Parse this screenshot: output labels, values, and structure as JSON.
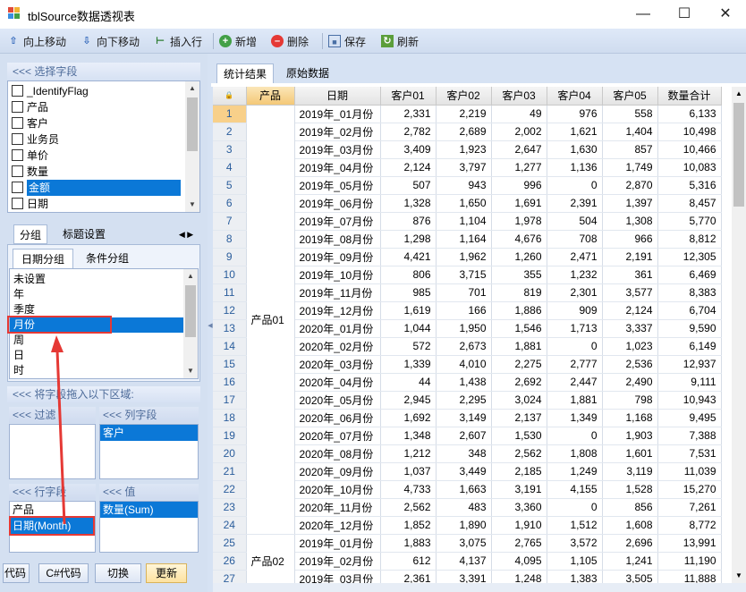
{
  "window": {
    "title": "tblSource数据透视表"
  },
  "toolbar": {
    "move_up": "向上移动",
    "move_down": "向下移动",
    "insert_row": "插入行",
    "add": "新增",
    "delete": "删除",
    "save": "保存",
    "refresh": "刷新"
  },
  "fields": {
    "header": "<<< 选择字段",
    "items": [
      "_IdentifyFlag",
      "产品",
      "客户",
      "业务员",
      "单价",
      "数量",
      "金额",
      "日期"
    ],
    "selected": "金额"
  },
  "group_tabs": {
    "tab1": "分组",
    "tab2": "标题设置"
  },
  "sub_tabs": {
    "tab1": "日期分组",
    "tab2": "条件分组"
  },
  "date_group": {
    "items": [
      "未设置",
      "年",
      "季度",
      "月份",
      "周",
      "日",
      "时"
    ],
    "selected": "月份"
  },
  "drop_area": {
    "header": "<<< 将字段拖入以下区域:",
    "filter_header": "<<< 过滤",
    "column_header": "<<< 列字段",
    "column_items": [
      "客户"
    ],
    "row_header": "<<< 行字段",
    "row_items": [
      "产品",
      "日期(Month)"
    ],
    "value_header": "<<< 值",
    "value_items": [
      "数量(Sum)"
    ]
  },
  "bottom_buttons": {
    "code": "代码",
    "csharp": "C#代码",
    "switch": "切换",
    "update": "更新"
  },
  "result_tabs": {
    "tab1": "统计结果",
    "tab2": "原始数据"
  },
  "grid": {
    "columns": [
      "产品",
      "日期",
      "客户01",
      "客户02",
      "客户03",
      "客户04",
      "客户05",
      "数量合计"
    ],
    "groups": [
      {
        "name": "产品01",
        "rows": 24
      },
      {
        "name": "产品02",
        "rows": 3
      }
    ],
    "rows": [
      [
        "1",
        "2019年_01月份",
        "2,331",
        "2,219",
        "49",
        "976",
        "558",
        "6,133"
      ],
      [
        "2",
        "2019年_02月份",
        "2,782",
        "2,689",
        "2,002",
        "1,621",
        "1,404",
        "10,498"
      ],
      [
        "3",
        "2019年_03月份",
        "3,409",
        "1,923",
        "2,647",
        "1,630",
        "857",
        "10,466"
      ],
      [
        "4",
        "2019年_04月份",
        "2,124",
        "3,797",
        "1,277",
        "1,136",
        "1,749",
        "10,083"
      ],
      [
        "5",
        "2019年_05月份",
        "507",
        "943",
        "996",
        "0",
        "2,870",
        "5,316"
      ],
      [
        "6",
        "2019年_06月份",
        "1,328",
        "1,650",
        "1,691",
        "2,391",
        "1,397",
        "8,457"
      ],
      [
        "7",
        "2019年_07月份",
        "876",
        "1,104",
        "1,978",
        "504",
        "1,308",
        "5,770"
      ],
      [
        "8",
        "2019年_08月份",
        "1,298",
        "1,164",
        "4,676",
        "708",
        "966",
        "8,812"
      ],
      [
        "9",
        "2019年_09月份",
        "4,421",
        "1,962",
        "1,260",
        "2,471",
        "2,191",
        "12,305"
      ],
      [
        "10",
        "2019年_10月份",
        "806",
        "3,715",
        "355",
        "1,232",
        "361",
        "6,469"
      ],
      [
        "11",
        "2019年_11月份",
        "985",
        "701",
        "819",
        "2,301",
        "3,577",
        "8,383"
      ],
      [
        "12",
        "2019年_12月份",
        "1,619",
        "166",
        "1,886",
        "909",
        "2,124",
        "6,704"
      ],
      [
        "13",
        "2020年_01月份",
        "1,044",
        "1,950",
        "1,546",
        "1,713",
        "3,337",
        "9,590"
      ],
      [
        "14",
        "2020年_02月份",
        "572",
        "2,673",
        "1,881",
        "0",
        "1,023",
        "6,149"
      ],
      [
        "15",
        "2020年_03月份",
        "1,339",
        "4,010",
        "2,275",
        "2,777",
        "2,536",
        "12,937"
      ],
      [
        "16",
        "2020年_04月份",
        "44",
        "1,438",
        "2,692",
        "2,447",
        "2,490",
        "9,111"
      ],
      [
        "17",
        "2020年_05月份",
        "2,945",
        "2,295",
        "3,024",
        "1,881",
        "798",
        "10,943"
      ],
      [
        "18",
        "2020年_06月份",
        "1,692",
        "3,149",
        "2,137",
        "1,349",
        "1,168",
        "9,495"
      ],
      [
        "19",
        "2020年_07月份",
        "1,348",
        "2,607",
        "1,530",
        "0",
        "1,903",
        "7,388"
      ],
      [
        "20",
        "2020年_08月份",
        "1,212",
        "348",
        "2,562",
        "1,808",
        "1,601",
        "7,531"
      ],
      [
        "21",
        "2020年_09月份",
        "1,037",
        "3,449",
        "2,185",
        "1,249",
        "3,119",
        "11,039"
      ],
      [
        "22",
        "2020年_10月份",
        "4,733",
        "1,663",
        "3,191",
        "4,155",
        "1,528",
        "15,270"
      ],
      [
        "23",
        "2020年_11月份",
        "2,562",
        "483",
        "3,360",
        "0",
        "856",
        "7,261"
      ],
      [
        "24",
        "2020年_12月份",
        "1,852",
        "1,890",
        "1,910",
        "1,512",
        "1,608",
        "8,772"
      ],
      [
        "25",
        "2019年_01月份",
        "1,883",
        "3,075",
        "2,765",
        "3,572",
        "2,696",
        "13,991"
      ],
      [
        "26",
        "2019年_02月份",
        "612",
        "4,137",
        "4,095",
        "1,105",
        "1,241",
        "11,190"
      ],
      [
        "27",
        "2019年_03月份",
        "2,361",
        "3,391",
        "1,248",
        "1,383",
        "3,505",
        "11,888"
      ]
    ]
  },
  "colors": {
    "selection": "#0b78d7",
    "annotation": "#e53935",
    "header_active": "#f4c877"
  }
}
